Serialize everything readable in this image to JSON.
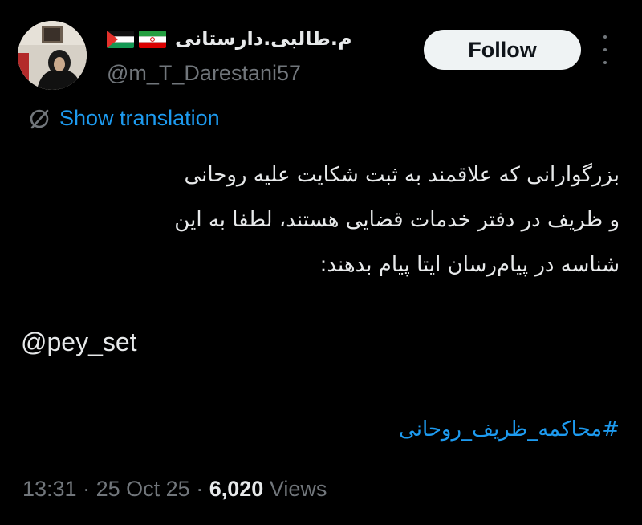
{
  "author": {
    "display_name": "م.طالبی.دارستانی",
    "flags": [
      "palestine-flag",
      "iran-flag"
    ],
    "handle": "@m_T_Darestani57"
  },
  "follow_label": "Follow",
  "translate_label": "Show translation",
  "body_lines": [
    "بزرگوارانی که علاقمند به ثبت شکایت علیه روحانی",
    "و ظریف در دفتر خدمات قضایی هستند، لطفا به این",
    "شناسه در پیام‌رسان ایتا پیام بدهند:"
  ],
  "mention": "@pey_set",
  "hashtag": "#محاکمه_ظریف_روحانی",
  "meta": {
    "time": "13:31",
    "separator": "·",
    "date": "25 Oct 25",
    "views_count": "6,020",
    "views_label": "Views"
  },
  "colors": {
    "background": "#000000",
    "text": "#e7e9ea",
    "secondary": "#71767b",
    "link": "#1d9bf0",
    "button_bg": "#eff3f4"
  }
}
